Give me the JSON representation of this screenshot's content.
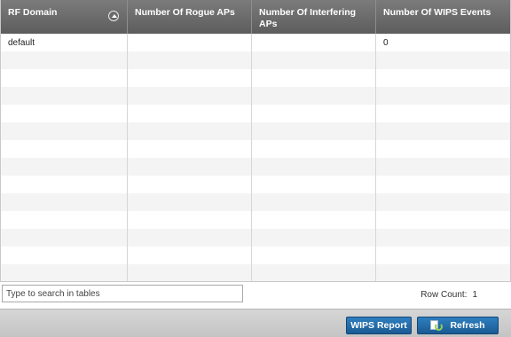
{
  "table": {
    "columns": [
      {
        "label": "RF Domain"
      },
      {
        "label": "Number Of Rogue APs"
      },
      {
        "label": "Number Of Interfering APs"
      },
      {
        "label": "Number Of WIPS Events"
      }
    ],
    "rows": [
      [
        "default",
        "",
        "",
        "0"
      ]
    ],
    "sort_icon": "sort-ascending-icon"
  },
  "search": {
    "placeholder": "Type to search in tables",
    "value": ""
  },
  "row_count": {
    "label": "Row Count:",
    "value": "1"
  },
  "actions": {
    "wips_report_label": "WIPS Report",
    "refresh_label": "Refresh",
    "refresh_icon": "refresh-icon"
  }
}
